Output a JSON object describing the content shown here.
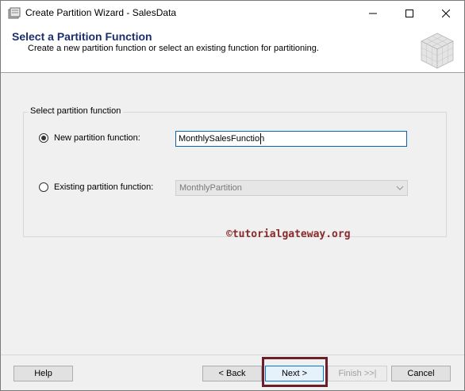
{
  "window": {
    "title": "Create Partition Wizard - SalesData",
    "controls": [
      "minimize-icon",
      "maximize-icon",
      "close-icon"
    ]
  },
  "header": {
    "title": "Select a Partition Function",
    "subtitle": "Create a new partition function or select an existing function for partitioning."
  },
  "group": {
    "label": "Select partition function",
    "new_option": {
      "label": "New partition function:",
      "selected": true,
      "value": "MonthlySalesFunction"
    },
    "existing_option": {
      "label": "Existing partition function:",
      "selected": false,
      "value": "MonthlyPartition",
      "enabled": false
    }
  },
  "watermark": "©tutorialgateway.org",
  "buttons": {
    "help": "Help",
    "back": "< Back",
    "next": "Next >",
    "finish": "Finish >>|",
    "cancel": "Cancel"
  },
  "colors": {
    "header_title": "#1a2f6d",
    "focus_border": "#0c62b0",
    "highlight_box": "#6b1f2a",
    "watermark": "#8a2a2a"
  }
}
